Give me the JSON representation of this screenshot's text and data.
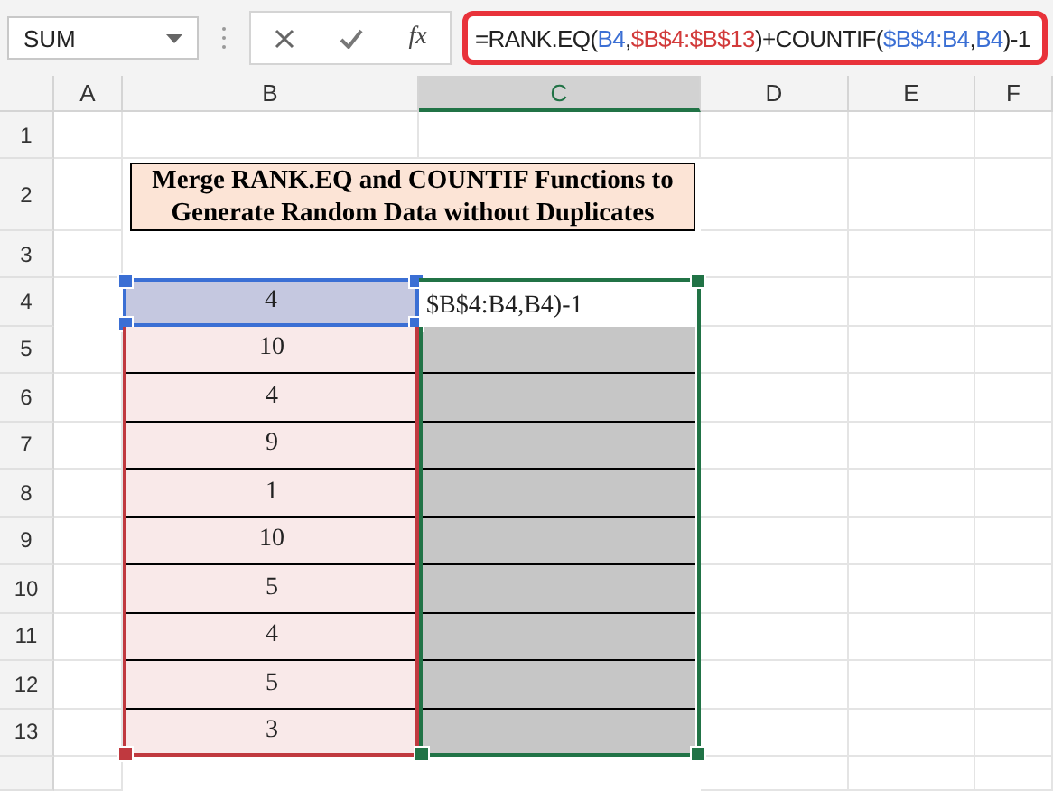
{
  "formula_bar": {
    "name_box": "SUM",
    "function_label": "fx",
    "formula": [
      {
        "text": "=RANK.EQ(",
        "color": "#222222"
      },
      {
        "text": "B4",
        "color": "#3b6fd4"
      },
      {
        "text": ",",
        "color": "#222222"
      },
      {
        "text": "$B$4:$B$13",
        "color": "#d23a3a"
      },
      {
        "text": ")+COUNTIF(",
        "color": "#222222"
      },
      {
        "text": "$B$4:B4",
        "color": "#3b6fd4"
      },
      {
        "text": ",",
        "color": "#222222"
      },
      {
        "text": "B4",
        "color": "#3b6fd4"
      },
      {
        "text": ")-1",
        "color": "#222222"
      }
    ]
  },
  "columns": [
    {
      "label": "A",
      "selected": false
    },
    {
      "label": "B",
      "selected": false
    },
    {
      "label": "C",
      "selected": true
    },
    {
      "label": "D",
      "selected": false
    },
    {
      "label": "E",
      "selected": false
    },
    {
      "label": "F",
      "selected": false
    }
  ],
  "rows": [
    "1",
    "2",
    "3",
    "4",
    "5",
    "6",
    "7",
    "8",
    "9",
    "10",
    "11",
    "12",
    "13"
  ],
  "title": "Merge RANK.EQ and COUNTIF Functions to Generate Random Data without Duplicates",
  "editing_cell_text": "$B$4:B4,B4)-1",
  "data": [
    {
      "value": "4",
      "selected": true
    },
    {
      "value": "10",
      "selected": false
    },
    {
      "value": "4",
      "selected": false
    },
    {
      "value": "9",
      "selected": false
    },
    {
      "value": "1",
      "selected": false
    },
    {
      "value": "10",
      "selected": false
    },
    {
      "value": "5",
      "selected": false
    },
    {
      "value": "4",
      "selected": false
    },
    {
      "value": "5",
      "selected": false
    },
    {
      "value": "3",
      "selected": false
    }
  ]
}
